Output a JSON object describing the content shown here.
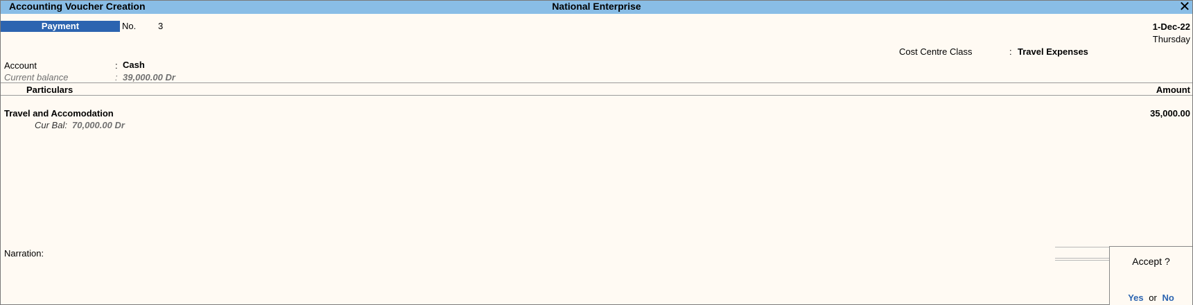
{
  "window": {
    "title": "Accounting Voucher Creation",
    "company": "National Enterprise",
    "close_glyph": "✕"
  },
  "voucher": {
    "type": "Payment",
    "no_label": "No.",
    "no_value": "3",
    "date": "1-Dec-22",
    "day": "Thursday"
  },
  "cost_centre": {
    "label": "Cost Centre Class",
    "sep": ":",
    "value": "Travel Expenses"
  },
  "account": {
    "label": "Account",
    "sep": ":",
    "value": "Cash",
    "balance_label": "Current balance",
    "balance_sep": ":",
    "balance_value": "39,000.00 Dr"
  },
  "table": {
    "col_particulars": "Particulars",
    "col_amount": "Amount",
    "rows": [
      {
        "particular": "Travel and Accomodation",
        "cur_bal_label": "Cur Bal:",
        "cur_bal_value": "70,000.00 Dr",
        "amount": "35,000.00"
      }
    ]
  },
  "narration": {
    "label": "Narration:",
    "value": ""
  },
  "accept_dialog": {
    "question": "Accept ?",
    "yes": "Yes",
    "or": "or",
    "no": "No"
  }
}
